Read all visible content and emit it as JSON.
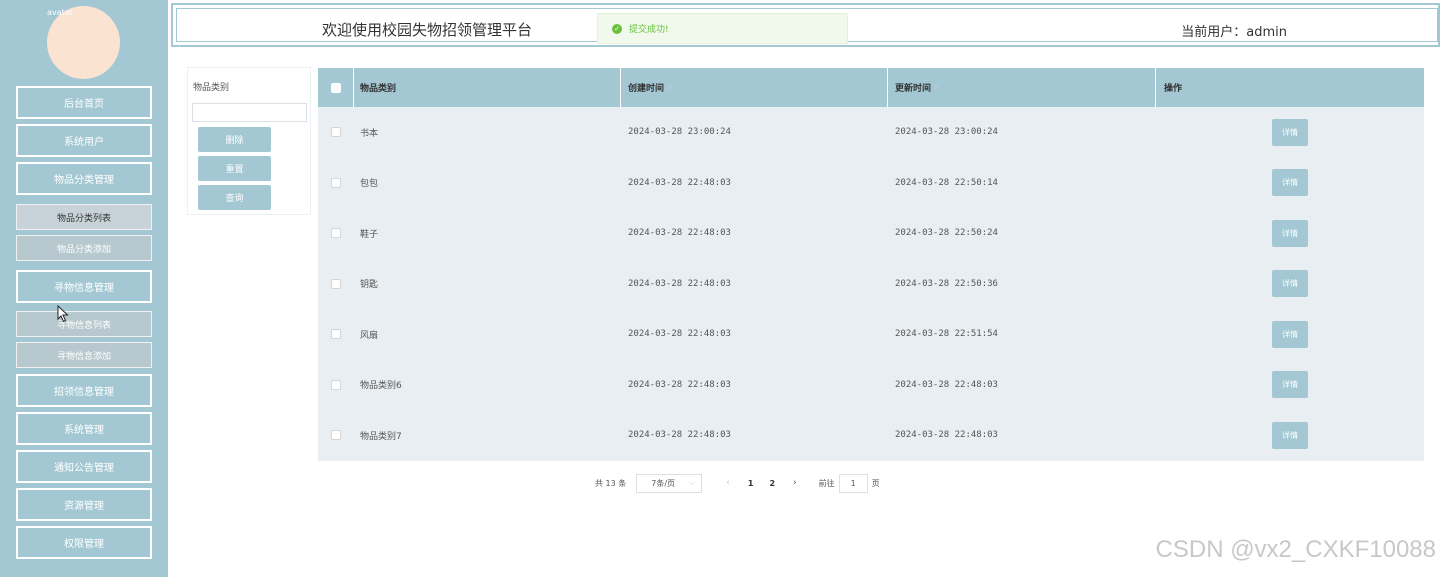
{
  "header": {
    "title": "欢迎使用校园失物招领管理平台",
    "current_user_label": "当前用户：",
    "current_user": "admin"
  },
  "toast": {
    "message": "提交成功!",
    "icon": "check-circle-icon"
  },
  "sidebar": {
    "avatar_alt": "avatar",
    "items": [
      {
        "label": "后台首页"
      },
      {
        "label": "系统用户"
      },
      {
        "label": "物品分类管理"
      },
      {
        "label": "物品分类列表"
      },
      {
        "label": "物品分类添加"
      },
      {
        "label": "寻物信息管理"
      },
      {
        "label": "寻物信息列表"
      },
      {
        "label": "寻物信息添加"
      },
      {
        "label": "招领信息管理"
      },
      {
        "label": "系统管理"
      },
      {
        "label": "通知公告管理"
      },
      {
        "label": "资源管理"
      },
      {
        "label": "权限管理"
      }
    ]
  },
  "filter": {
    "label": "物品类别",
    "input_value": "",
    "delete_label": "删除",
    "reset_label": "重置",
    "query_label": "查询"
  },
  "table": {
    "headers": [
      "物品类别",
      "创建时间",
      "更新时间",
      "操作"
    ],
    "detail_label": "详情",
    "rows": [
      {
        "category": "书本",
        "created": "2024-03-28 23:00:24",
        "updated": "2024-03-28 23:00:24"
      },
      {
        "category": "包包",
        "created": "2024-03-28 22:48:03",
        "updated": "2024-03-28 22:50:14"
      },
      {
        "category": "鞋子",
        "created": "2024-03-28 22:48:03",
        "updated": "2024-03-28 22:50:24"
      },
      {
        "category": "钥匙",
        "created": "2024-03-28 22:48:03",
        "updated": "2024-03-28 22:50:36"
      },
      {
        "category": "风扇",
        "created": "2024-03-28 22:48:03",
        "updated": "2024-03-28 22:51:54"
      },
      {
        "category": "物品类别6",
        "created": "2024-03-28 22:48:03",
        "updated": "2024-03-28 22:48:03"
      },
      {
        "category": "物品类别7",
        "created": "2024-03-28 22:48:03",
        "updated": "2024-03-28 22:48:03"
      }
    ]
  },
  "pagination": {
    "total": "共 13 条",
    "page_size": "7条/页",
    "pages": [
      "1",
      "2"
    ],
    "current_page": "1",
    "goto_label": "前往",
    "goto_value": "1",
    "page_suffix": "页"
  },
  "watermark": "CSDN @vx2_CXKF10088"
}
